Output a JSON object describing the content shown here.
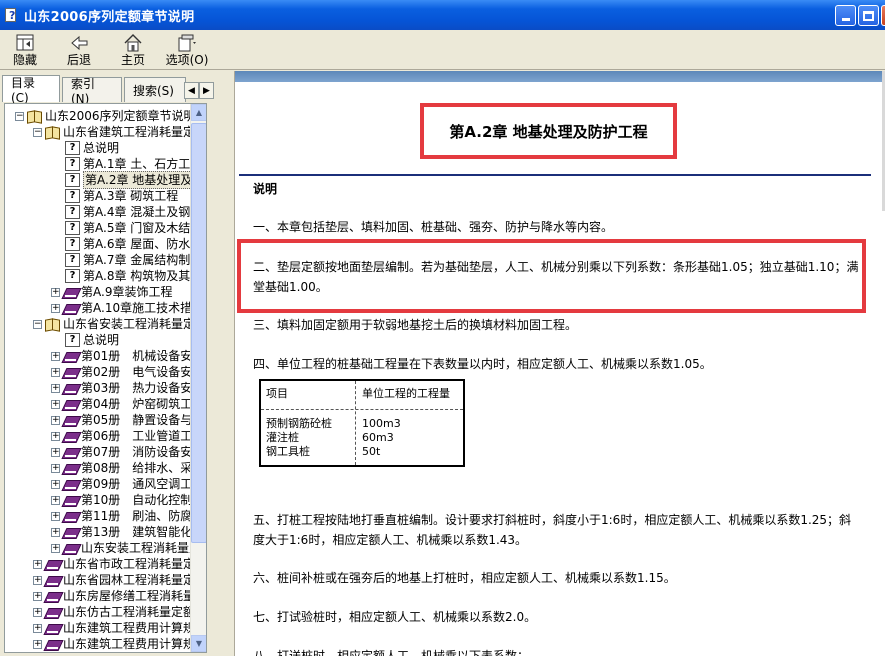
{
  "window": {
    "title": "山东2006序列定额章节说明"
  },
  "toolbar": {
    "items": [
      {
        "label": "隐藏",
        "icon": "hide-icon"
      },
      {
        "label": "后退",
        "icon": "back-arrow-icon"
      },
      {
        "label": "主页",
        "icon": "home-icon"
      },
      {
        "label": "选项(O)",
        "icon": "options-icon"
      }
    ]
  },
  "tabs": [
    {
      "label": "目录(C)",
      "active": true
    },
    {
      "label": "索引(N)",
      "active": false
    },
    {
      "label": "搜索(S)",
      "active": false
    }
  ],
  "tree": [
    {
      "level": 0,
      "expander": "-",
      "icon": "book-open",
      "label": "山东2006序列定额章节说明"
    },
    {
      "level": 1,
      "expander": "-",
      "icon": "book-open",
      "label": "山东省建筑工程消耗量定额"
    },
    {
      "level": 2,
      "expander": "",
      "icon": "q",
      "label": "总说明"
    },
    {
      "level": 2,
      "expander": "",
      "icon": "q",
      "label": "第A.1章 土、石方工程"
    },
    {
      "level": 2,
      "expander": "",
      "icon": "q",
      "label": "第A.2章 地基处理及防护工程",
      "selected": true
    },
    {
      "level": 2,
      "expander": "",
      "icon": "q",
      "label": "第A.3章 砌筑工程"
    },
    {
      "level": 2,
      "expander": "",
      "icon": "q",
      "label": "第A.4章 混凝土及钢筋混凝土工程"
    },
    {
      "level": 2,
      "expander": "",
      "icon": "q",
      "label": "第A.5章 门窗及木结构工程"
    },
    {
      "level": 2,
      "expander": "",
      "icon": "q",
      "label": "第A.6章 屋面、防水工程"
    },
    {
      "level": 2,
      "expander": "",
      "icon": "q",
      "label": "第A.7章 金属结构制作工程"
    },
    {
      "level": 2,
      "expander": "",
      "icon": "q",
      "label": "第A.8章 构筑物及其他工程"
    },
    {
      "level": 2,
      "expander": "+",
      "icon": "book",
      "label": "第A.9章装饰工程"
    },
    {
      "level": 2,
      "expander": "+",
      "icon": "book",
      "label": "第A.10章施工技术措施项目"
    },
    {
      "level": 1,
      "expander": "-",
      "icon": "book-open",
      "label": "山东省安装工程消耗量定额"
    },
    {
      "level": 2,
      "expander": "",
      "icon": "q",
      "label": "总说明"
    },
    {
      "level": 2,
      "expander": "+",
      "icon": "book",
      "label": "第01册　机械设备安装工程"
    },
    {
      "level": 2,
      "expander": "+",
      "icon": "book",
      "label": "第02册　电气设备安装工程"
    },
    {
      "level": 2,
      "expander": "+",
      "icon": "book",
      "label": "第03册　热力设备安装工程"
    },
    {
      "level": 2,
      "expander": "+",
      "icon": "book",
      "label": "第04册　炉窑砌筑工程"
    },
    {
      "level": 2,
      "expander": "+",
      "icon": "book",
      "label": "第05册　静置设备与工艺金属结构"
    },
    {
      "level": 2,
      "expander": "+",
      "icon": "book",
      "label": "第06册　工业管道工程"
    },
    {
      "level": 2,
      "expander": "+",
      "icon": "book",
      "label": "第07册　消防设备安装工程"
    },
    {
      "level": 2,
      "expander": "+",
      "icon": "book",
      "label": "第08册　给排水、采暖、燃气工程"
    },
    {
      "level": 2,
      "expander": "+",
      "icon": "book",
      "label": "第09册　通风空调工程"
    },
    {
      "level": 2,
      "expander": "+",
      "icon": "book",
      "label": "第10册　自动化控制仪表安装工程"
    },
    {
      "level": 2,
      "expander": "+",
      "icon": "book",
      "label": "第11册　刷油、防腐蚀、绝热工程"
    },
    {
      "level": 2,
      "expander": "+",
      "icon": "book",
      "label": "第13册　建筑智能化系统设备安装工程"
    },
    {
      "level": 2,
      "expander": "+",
      "icon": "book",
      "label": "山东安装工程消耗量定额附录"
    },
    {
      "level": 1,
      "expander": "+",
      "icon": "book",
      "label": "山东省市政工程消耗量定额"
    },
    {
      "level": 1,
      "expander": "+",
      "icon": "book",
      "label": "山东省园林工程消耗量定额"
    },
    {
      "level": 1,
      "expander": "+",
      "icon": "book",
      "label": "山东房屋修缮工程消耗量定额"
    },
    {
      "level": 1,
      "expander": "+",
      "icon": "book",
      "label": "山东仿古工程消耗量定额"
    },
    {
      "level": 1,
      "expander": "+",
      "icon": "book",
      "label": "山东建筑工程费用计算规则"
    },
    {
      "level": 1,
      "expander": "+",
      "icon": "book",
      "label": "山东建筑工程费用计算规则"
    }
  ],
  "doc": {
    "chapter_title": "第A.2章 地基处理及防护工程",
    "section_heading": "说明",
    "p1": "一、本章包括垫层、填料加固、桩基础、强夯、防护与降水等内容。",
    "p2": "二、垫层定额按地面垫层编制。若为基础垫层，人工、机械分别乘以下列系数：条形基础1.05；独立基础1.10；满堂基础1.00。",
    "p3": "三、填料加固定额用于软弱地基挖土后的换填材料加固工程。",
    "p4": "四、单位工程的桩基础工程量在下表数量以内时，相应定额人工、机械乘以系数1.05。",
    "table": {
      "header": [
        "项目",
        "单位工程的工程量"
      ],
      "rows": [
        [
          "预制钢筋砼桩",
          "100m3"
        ],
        [
          "灌注桩",
          "60m3"
        ],
        [
          "钢工具桩",
          "50t"
        ]
      ]
    },
    "p5": "五、打桩工程按陆地打垂直桩编制。设计要求打斜桩时，斜度小于1:6时，相应定额人工、机械乘以系数1.25；斜度大于1:6时，相应定额人工、机械乘以系数1.43。",
    "p6": "六、桩间补桩或在强夯后的地基上打桩时，相应定额人工、机械乘以系数1.15。",
    "p7": "七、打试验桩时，相应定额人工、机械乘以系数2.0。",
    "p8": "八、打送桩时，相应定额人工、机械乘以下表系数："
  },
  "colors": {
    "highlight_border": "#e43a3f",
    "title_bar": "#0a5fe0",
    "rule": "#1b2f7a"
  }
}
